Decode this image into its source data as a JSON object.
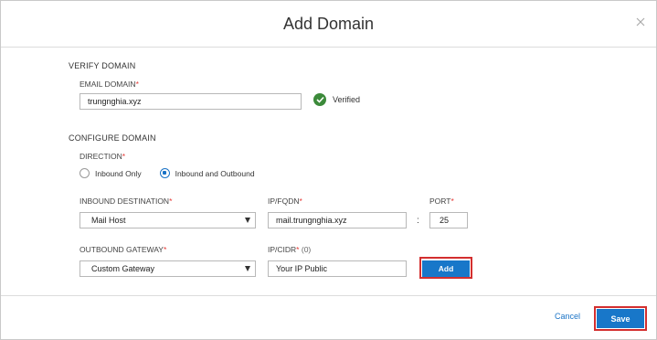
{
  "dialog": {
    "title": "Add Domain",
    "close_icon": "close-icon"
  },
  "verify_domain": {
    "section_title": "VERIFY DOMAIN",
    "email_domain": {
      "label": "EMAIL DOMAIN",
      "required_mark": "*",
      "value": "trungnghia.xyz"
    },
    "status": {
      "icon": "check-circle-icon",
      "text": "Verified",
      "color": "#3c8a3a"
    }
  },
  "configure_domain": {
    "section_title": "CONFIGURE DOMAIN",
    "direction": {
      "label": "DIRECTION",
      "required_mark": "*",
      "options": [
        {
          "label": "Inbound Only",
          "selected": false
        },
        {
          "label": "Inbound and Outbound",
          "selected": true
        }
      ]
    },
    "inbound_destination": {
      "label": "INBOUND DESTINATION",
      "required_mark": "*",
      "selected": "Mail Host"
    },
    "ip_fqdn": {
      "label": "IP/FQDN",
      "required_mark": "*",
      "value": "mail.trungnghia.xyz"
    },
    "separator": ":",
    "port": {
      "label": "PORT",
      "required_mark": "*",
      "value": "25"
    },
    "outbound_gateway": {
      "label": "OUTBOUND GATEWAY",
      "required_mark": "*",
      "selected": "Custom Gateway"
    },
    "ip_cidr": {
      "label": "IP/CIDR",
      "required_mark": "*",
      "count": "(0)",
      "value": "Your IP Public"
    },
    "add_button": "Add"
  },
  "footer": {
    "cancel_label": "Cancel",
    "save_label": "Save"
  },
  "colors": {
    "accent": "#1877c9",
    "highlight_border": "#d32f2f",
    "required": "#e53935"
  }
}
